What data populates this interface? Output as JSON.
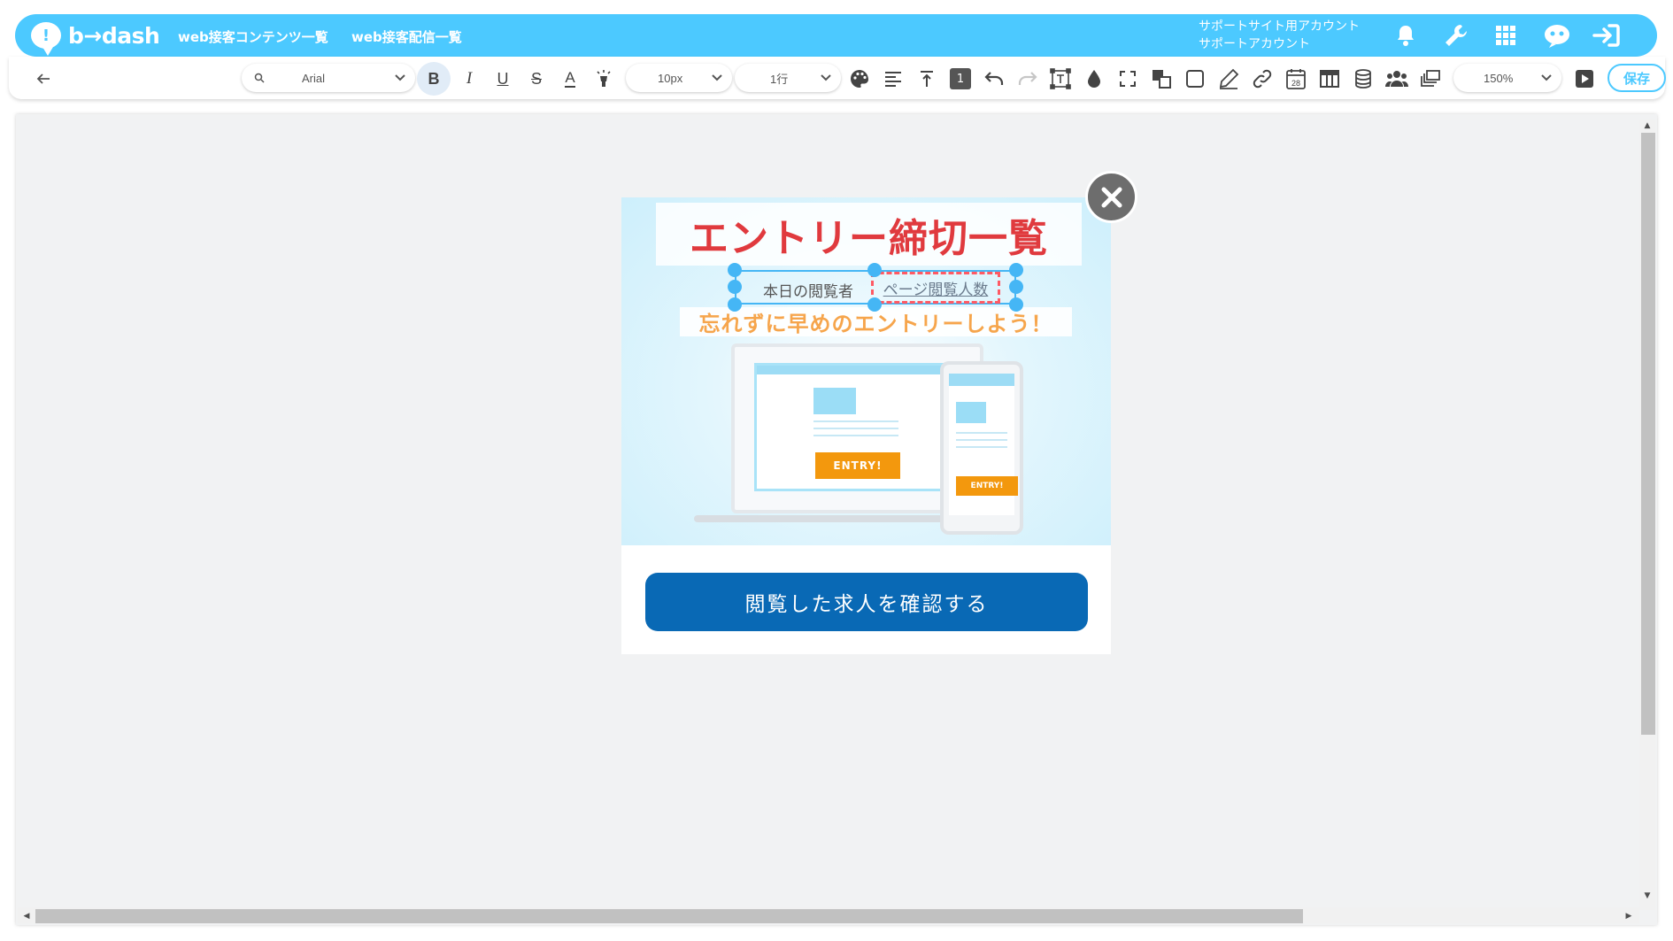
{
  "app": {
    "logo_text": "b→dash",
    "nav_links": [
      "web接客コンテンツ一覧",
      "web接客配信一覧"
    ],
    "account": {
      "line1": "サポートサイト用アカウント",
      "line2": "サポートアカウント"
    },
    "nav_icons": [
      "bell-icon",
      "wrench-icon",
      "app-grid-icon",
      "chatbot-icon",
      "logout-icon"
    ]
  },
  "toolbar": {
    "font_family": "Arial",
    "font_size": "10px",
    "line_height": "1行",
    "zoom": "150%",
    "save_label": "保存",
    "badge_number": "1",
    "calendar_day": "28",
    "colors": {
      "accent": "#4cc9ff",
      "bold_active_bg": "#e1ecf7"
    }
  },
  "popup": {
    "title": "エントリー締切一覧",
    "viewer_label": "本日の閲覧者",
    "viewer_value": "ページ閲覧人数",
    "subtitle": "忘れずに早めのエントリーしよう！",
    "laptop_entry": "ENTRY!",
    "phone_entry": "ENTRY!",
    "cta_label": "閲覧した求人を確認する",
    "colors": {
      "title": "#e03a3e",
      "subtitle": "#f6a54c",
      "cta": "#0969b5",
      "entry": "#f3980d",
      "selection": "#45b6f5",
      "dashed": "#ff5a64"
    }
  }
}
